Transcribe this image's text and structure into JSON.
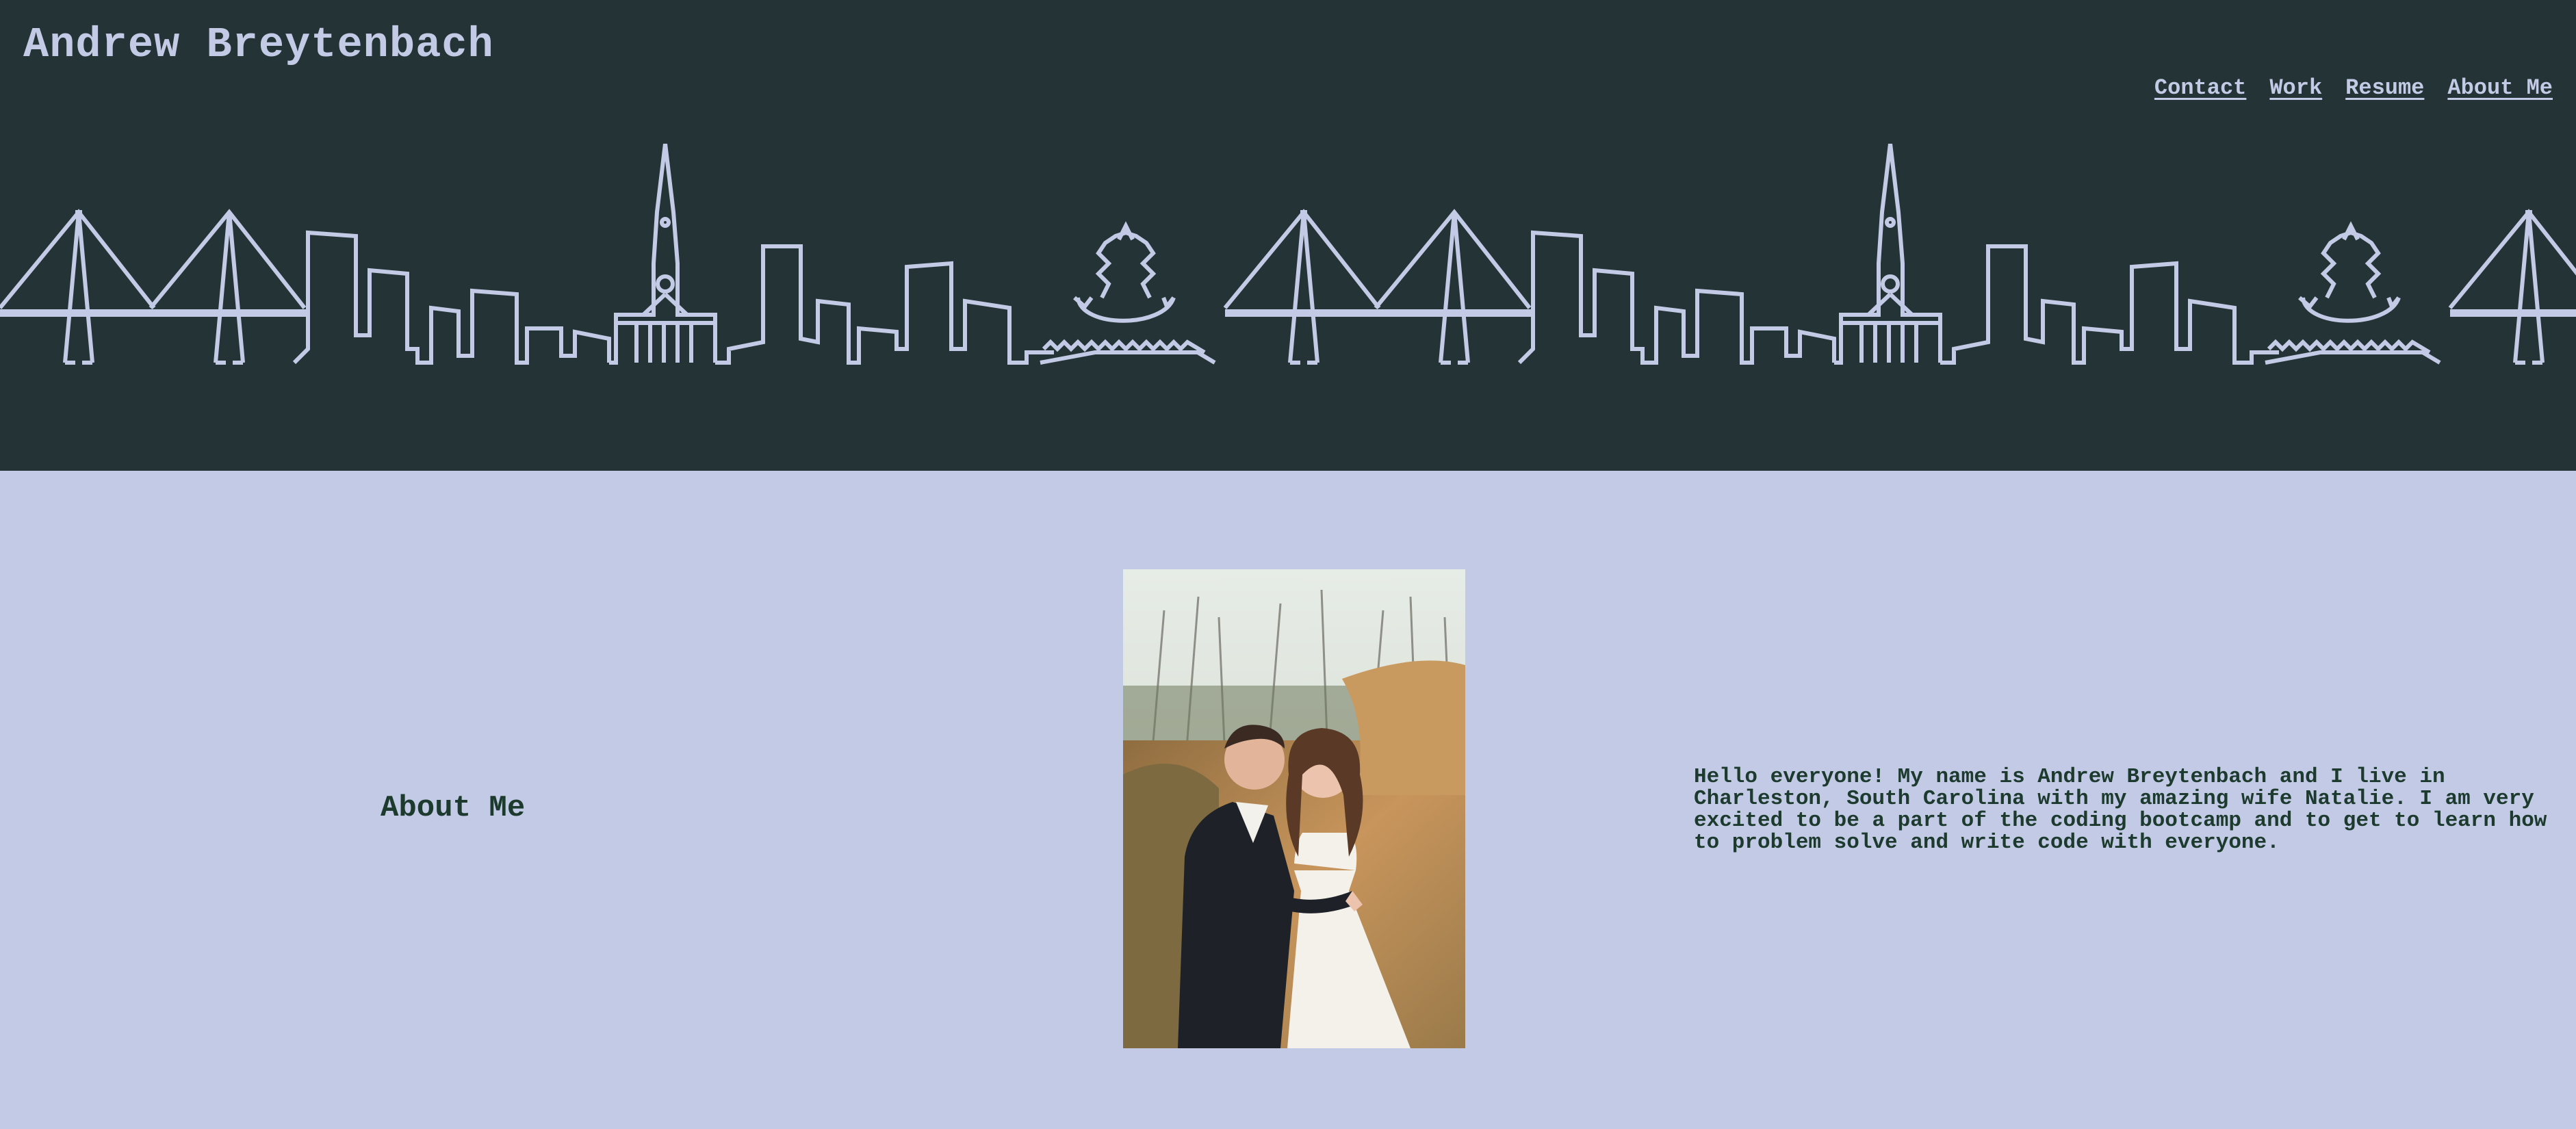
{
  "header": {
    "title": "Andrew Breytenbach",
    "nav": [
      {
        "label": "Contact"
      },
      {
        "label": "Work"
      },
      {
        "label": "Resume"
      },
      {
        "label": "About Me"
      }
    ],
    "skyline_icon": "charleston-skyline-icon"
  },
  "about": {
    "heading": "About Me",
    "photo_icon": "couple-portrait-image",
    "bio": "Hello everyone! My name is Andrew Breytenbach and I live in Charleston, South Carolina with my amazing wife Natalie. I am very excited to be a part of the coding bootcamp and to get to learn how to problem solve and write code with everyone."
  },
  "colors": {
    "header_bg": "#243436",
    "page_bg": "#c3cae5",
    "accent": "#c3cae5",
    "text_dark": "#1c3b2e"
  }
}
